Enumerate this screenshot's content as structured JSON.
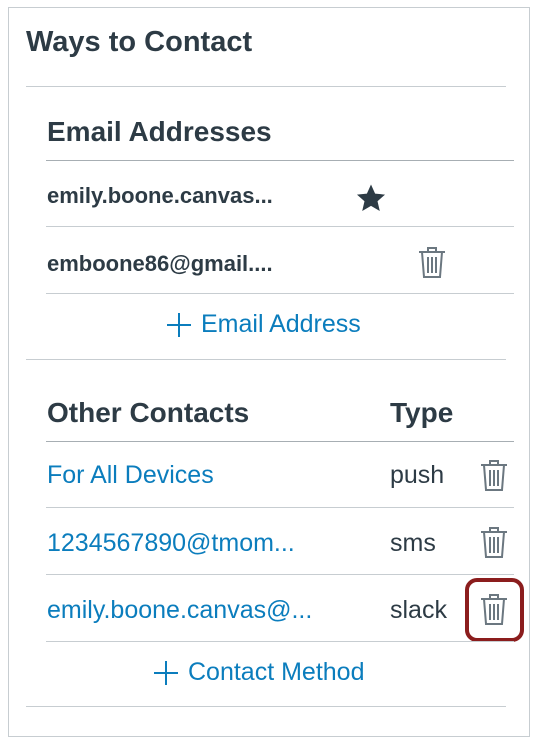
{
  "panel": {
    "title": "Ways to Contact"
  },
  "emails": {
    "heading": "Email Addresses",
    "items": [
      {
        "address": "emily.boone.canvas...",
        "icon": "star-icon"
      },
      {
        "address": "emboone86@gmail....",
        "icon": "trash-icon"
      }
    ],
    "add_label": "Email Address"
  },
  "other": {
    "heading": "Other Contacts",
    "type_heading": "Type",
    "items": [
      {
        "contact": "For All Devices",
        "type": "push",
        "icon": "trash-icon"
      },
      {
        "contact": "1234567890@tmom...",
        "type": "sms",
        "icon": "trash-icon"
      },
      {
        "contact": "emily.boone.canvas@...",
        "type": "slack",
        "icon": "trash-icon"
      }
    ],
    "add_label": "Contact Method"
  },
  "colors": {
    "link": "#0b7dbd",
    "text": "#2d3b45",
    "divider": "#c7cdd1",
    "highlight": "#8b1d1d"
  }
}
